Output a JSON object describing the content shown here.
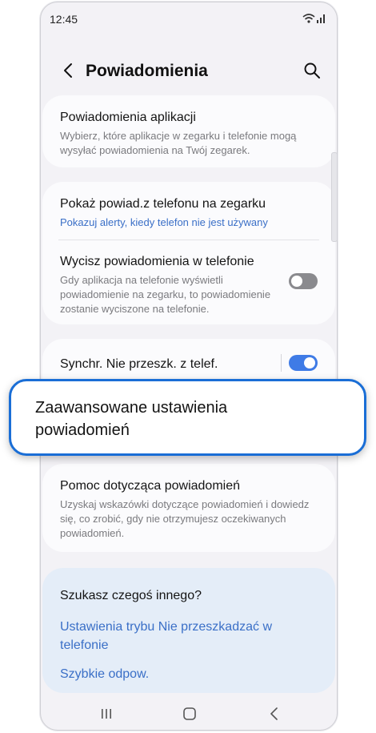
{
  "status_bar": {
    "time": "12:45"
  },
  "header": {
    "title": "Powiadomienia"
  },
  "settings": {
    "app_notifications": {
      "title": "Powiadomienia aplikacji",
      "subtitle": "Wybierz, które aplikacje w zegarku i telefonie mogą wysyłać powiadomienia na Twój zegarek."
    },
    "show_phone_notifications": {
      "title": "Pokaż powiad.z telefonu na zegarku",
      "subtitle": "Pokazuj alerty, kiedy telefon nie jest używany"
    },
    "mute_on_phone": {
      "title": "Wycisz powiadomienia w telefonie",
      "subtitle": "Gdy aplikacja na telefonie wyświetli powiadomienie na zegarku, to powiadomienie zostanie wyciszone na telefonie.",
      "enabled": false
    },
    "sync_dnd": {
      "title": "Synchr. Nie przeszk. z telef.",
      "enabled": true
    },
    "advanced": {
      "title": "Zaawansowane ustawienia powiadomień"
    },
    "help": {
      "title": "Pomoc dotycząca powiadomień",
      "subtitle": "Uzyskaj wskazówki dotyczące powiadomień i dowiedz się, co zrobić, gdy nie otrzymujesz oczekiwanych powiadomień."
    }
  },
  "looking_for_more": {
    "question": "Szukasz czegoś innego?",
    "links": [
      "Ustawienia trybu Nie przeszkadzać w telefonie",
      "Szybkie odpow."
    ]
  },
  "colors": {
    "accent": "#3f7be6",
    "link": "#3a6fc7",
    "highlight_border": "#1a6ed6"
  }
}
